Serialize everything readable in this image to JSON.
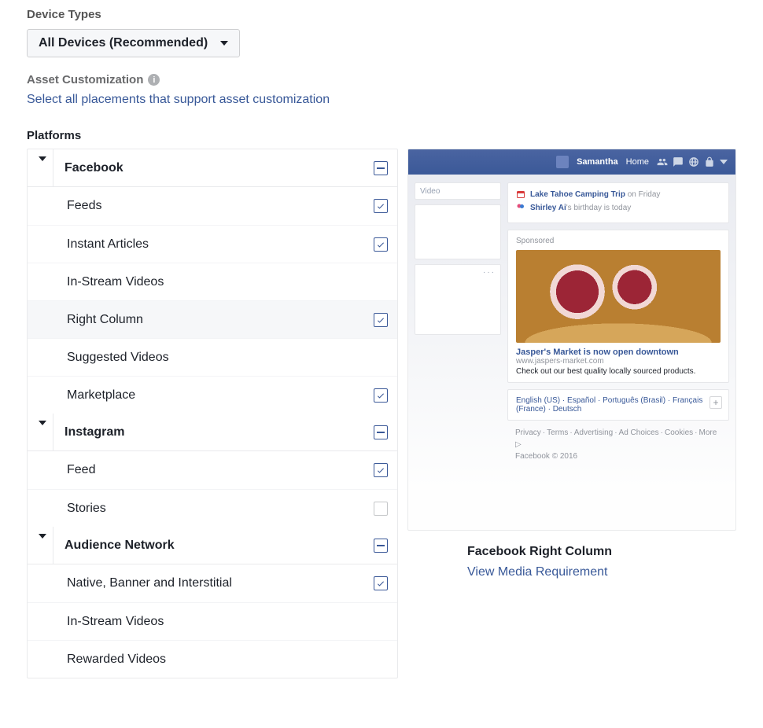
{
  "deviceTypes": {
    "label": "Device Types",
    "selected": "All Devices (Recommended)"
  },
  "assetCustomization": {
    "label": "Asset Customization",
    "link": "Select all placements that support asset customization"
  },
  "platforms": {
    "label": "Platforms",
    "groups": [
      {
        "name": "Facebook",
        "state": "partial",
        "items": [
          {
            "label": "Feeds",
            "state": "checked"
          },
          {
            "label": "Instant Articles",
            "state": "checked"
          },
          {
            "label": "In-Stream Videos",
            "state": "none"
          },
          {
            "label": "Right Column",
            "state": "checked",
            "highlight": true
          },
          {
            "label": "Suggested Videos",
            "state": "none"
          },
          {
            "label": "Marketplace",
            "state": "checked"
          }
        ]
      },
      {
        "name": "Instagram",
        "state": "partial",
        "items": [
          {
            "label": "Feed",
            "state": "checked"
          },
          {
            "label": "Stories",
            "state": "unchecked"
          }
        ]
      },
      {
        "name": "Audience Network",
        "state": "partial",
        "items": [
          {
            "label": "Native, Banner and Interstitial",
            "state": "checked"
          },
          {
            "label": "In-Stream Videos",
            "state": "none"
          },
          {
            "label": "Rewarded Videos",
            "state": "none"
          }
        ]
      }
    ]
  },
  "preview": {
    "topbar": {
      "name": "Samantha",
      "home": "Home"
    },
    "videoBlock": "Video",
    "events": {
      "title": "Lake Tahoe Camping Trip",
      "when": "on Friday",
      "birthday_name": "Shirley Ai",
      "birthday_suffix": "'s birthday is today"
    },
    "sponsored": {
      "label": "Sponsored",
      "title": "Jasper's Market is now open downtown",
      "url": "www.jaspers-market.com",
      "desc": "Check out our best quality locally sourced products."
    },
    "langs": [
      "English (US)",
      "Español",
      "Português (Brasil)",
      "Français (France)",
      "Deutsch"
    ],
    "footer": [
      "Privacy",
      "Terms",
      "Advertising",
      "Ad Choices",
      "Cookies",
      "More"
    ],
    "copyright": "Facebook © 2016",
    "summaryTitle": "Facebook Right Column",
    "mediaLink": "View Media Requirement"
  }
}
